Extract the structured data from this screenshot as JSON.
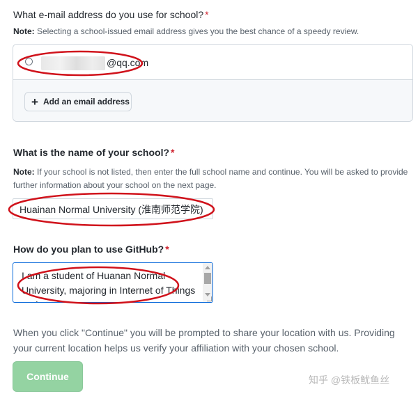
{
  "email_section": {
    "label": "What e-mail address do you use for school?",
    "required_mark": "*",
    "note_strong": "Note:",
    "note_text": " Selecting a school-issued email address gives you the best chance of a speedy review.",
    "option_domain": "@qq.com",
    "add_button_label": "Add an email address",
    "add_icon": "plus-icon"
  },
  "school_section": {
    "label": "What is the name of your school?",
    "required_mark": "*",
    "note_strong": "Note:",
    "note_text": " If your school is not listed, then enter the full school name and continue. You will be asked to provide further information about your school on the next page.",
    "input_value": "Huainan Normal University (淮南师范学院)"
  },
  "usage_section": {
    "label": "How do you plan to use GitHub?",
    "required_mark": "*",
    "textarea_value": "I am a student of Huanan Normal University, majoring in Internet of Things and studying..."
  },
  "footer": {
    "prompt_text": "When you click \"Continue\" you will be prompted to share your location with us. Providing your current location helps us verify your affiliation with your chosen school.",
    "continue_label": "Continue"
  },
  "watermark": "知乎 @铁板鱿鱼丝",
  "colors": {
    "required": "#cf222e",
    "continue_button": "#94d3a2",
    "annotation_ellipse": "#d0121b",
    "focus_border": "#0969da"
  }
}
